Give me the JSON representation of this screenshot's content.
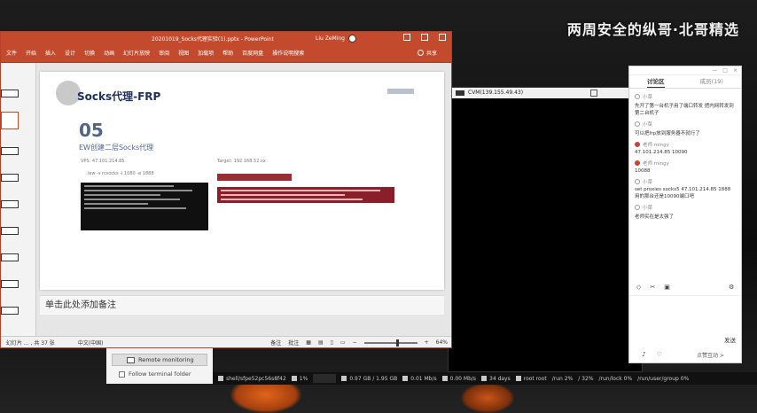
{
  "watermark": "两周安全的纵哥·北哥精选",
  "ppt": {
    "title": "20201019_Socks代理实验(1).pptx - PowerPoint",
    "user": "Liu ZeMing",
    "tabs": [
      "文件",
      "开始",
      "插入",
      "设计",
      "切换",
      "动画",
      "幻灯片放映",
      "审阅",
      "视图",
      "加载项",
      "帮助",
      "百度网盘",
      "操作说明搜索"
    ],
    "share_label": "共享",
    "slide": {
      "section_title": "Socks代理-FRP",
      "number": "05",
      "subtitle": "EW创建二层Socks代理",
      "label_left": "VPS: 47.101.214.85",
      "label_left2": "./ew -s rcsocks -l 1080 -e 1888",
      "label_right": "Target: 192.168.52.xx"
    },
    "notes_placeholder": "单击此处添加备注",
    "status": {
      "slide_count": "幻灯片 ... , 共 37 张",
      "language": "中文(中国)",
      "notes_label": "备注",
      "comments_label": "批注",
      "zoom": "64%"
    }
  },
  "terminal": {
    "title": "CVM(139.155.49.43)",
    "status_items": [
      "shell/sfpe52pc56s8f42",
      "1%",
      "0.97 GB / 1.95 GB",
      "0.01 Mb/s",
      "0.00 Mb/s",
      "34 days",
      "root root",
      "/run 2%",
      "/ 32%",
      "/run/lock 0%",
      "/run/user/group 0%"
    ]
  },
  "remote_panel": {
    "monitoring_button": "Remote monitoring",
    "follow_label": "Follow terminal folder"
  },
  "chat": {
    "tab_discussion": "讨论区",
    "tab_count": "成员(19)",
    "messages": [
      {
        "who": "小菜",
        "text": "先开了第一台机子用了端口转发 把内网转发到第二台机子",
        "red": false
      },
      {
        "who": "小菜",
        "text": "可以把frp放到服务器不就行了",
        "red": false
      },
      {
        "who": "老师 mingy",
        "text": "47.101.214.85 10090",
        "red": true
      },
      {
        "who": "老师 mingy",
        "text": "10088",
        "red": true
      },
      {
        "who": "小菜",
        "text": "set proxies socks5 47.101.214.85 1888 用的那台还是10090端口吧",
        "red": false
      },
      {
        "who": "小菜",
        "text": "老师实在是太强了",
        "red": false
      }
    ],
    "send_label": "发送",
    "bottom_link": "点赞互动 >"
  }
}
